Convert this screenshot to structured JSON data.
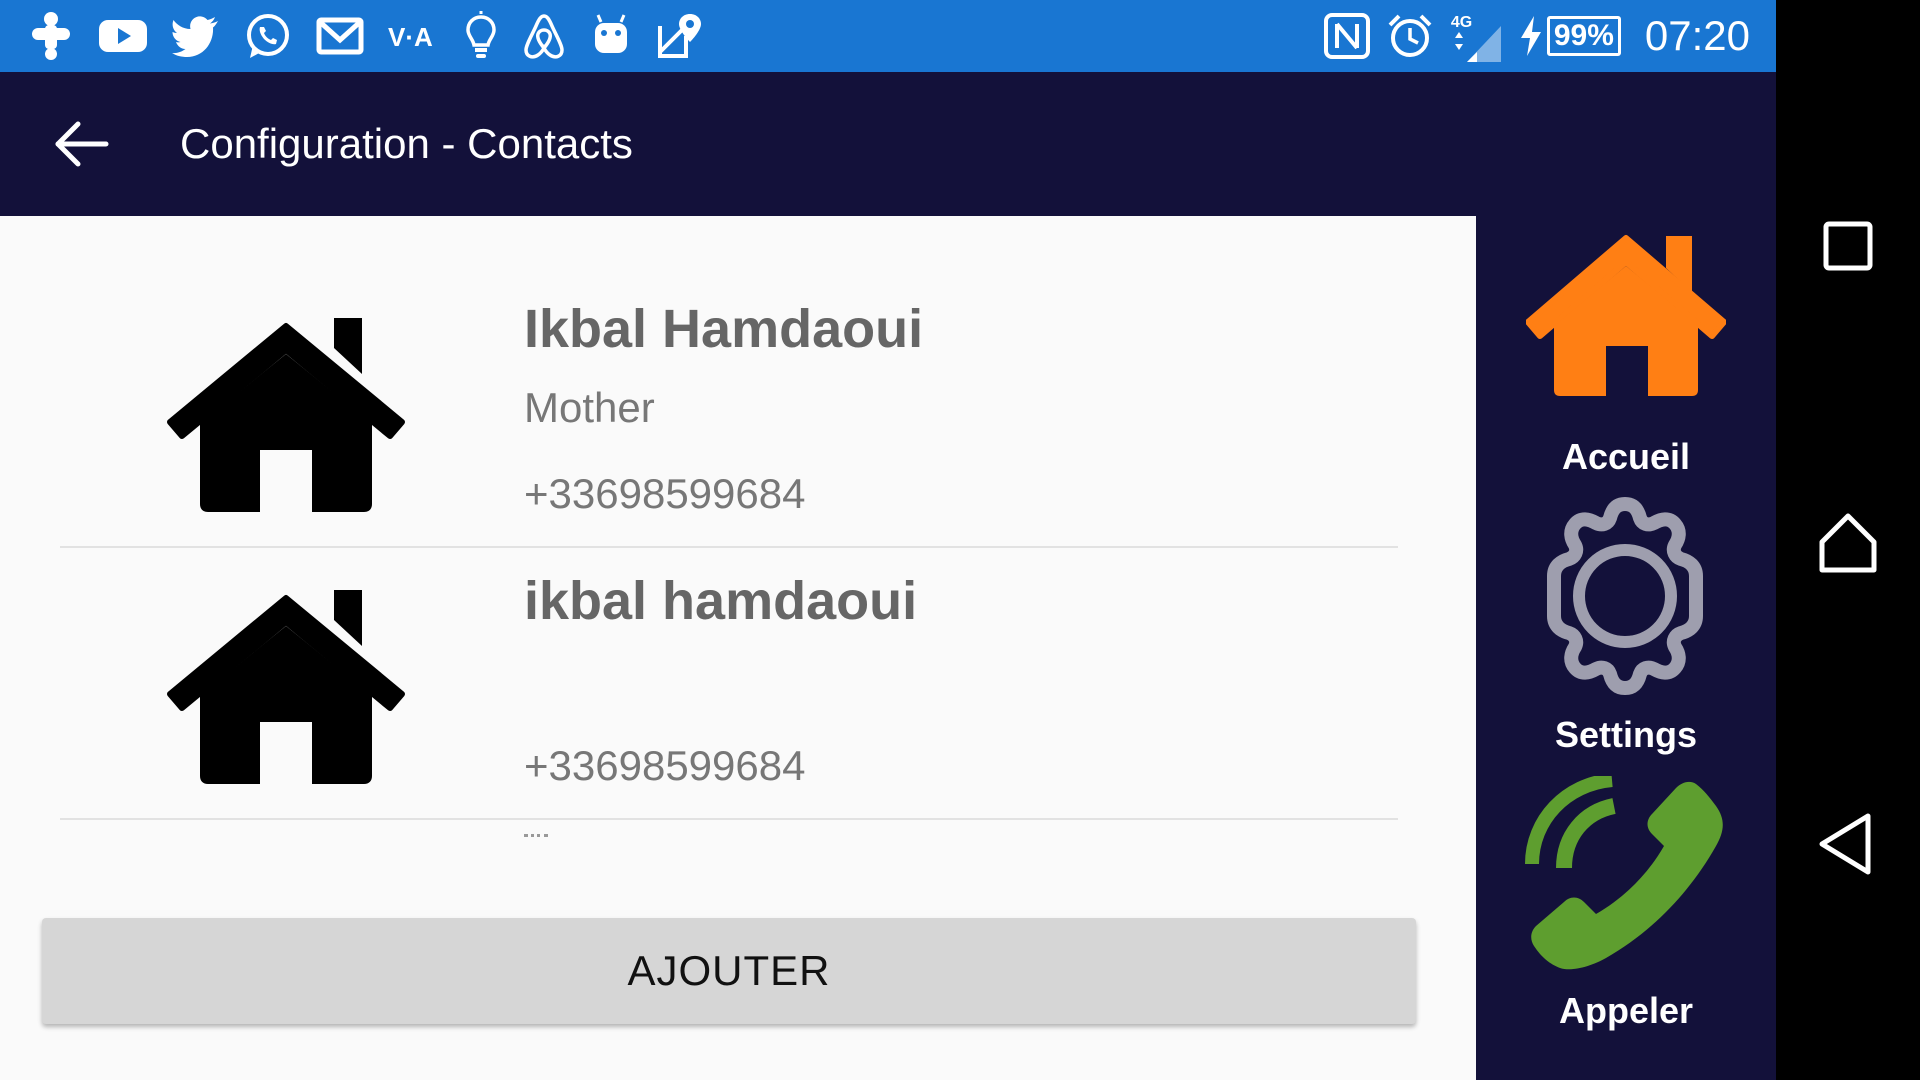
{
  "status_bar": {
    "notification_icons": [
      "game-controller-icon",
      "youtube-icon",
      "twitter-icon",
      "whatsapp-icon",
      "gmail-icon",
      "vla-icon",
      "lightbulb-icon",
      "airbnb-icon",
      "android-icon",
      "maps-icon"
    ],
    "nfc_icon": "nfc-icon",
    "alarm_icon": "alarm-icon",
    "network_label": "4G",
    "battery_percent": "99%",
    "time": "07:20",
    "color": "#1976D2"
  },
  "toolbar": {
    "title": "Configuration - Contacts",
    "back_icon": "arrow-left-icon",
    "color": "#13113A"
  },
  "contacts": [
    {
      "name": "Ikbal Hamdaoui",
      "relation": "Mother",
      "phone": "+33698599684",
      "icon": "house-icon"
    },
    {
      "name": "ikbal hamdaoui",
      "relation": "",
      "phone": "+33698599684",
      "icon": "house-icon"
    }
  ],
  "add_button": {
    "label": "AJOUTER"
  },
  "sidebar": {
    "items": [
      {
        "label": "Accueil",
        "icon": "home-icon",
        "color": "#FF7F14"
      },
      {
        "label": "Settings",
        "icon": "gear-icon",
        "color": "#9E9EAE"
      },
      {
        "label": "Appeler",
        "icon": "phone-icon",
        "color": "#5E9E2F"
      }
    ]
  },
  "nav_bar": {
    "buttons": [
      "recent-apps-icon",
      "home-icon",
      "back-icon"
    ]
  }
}
